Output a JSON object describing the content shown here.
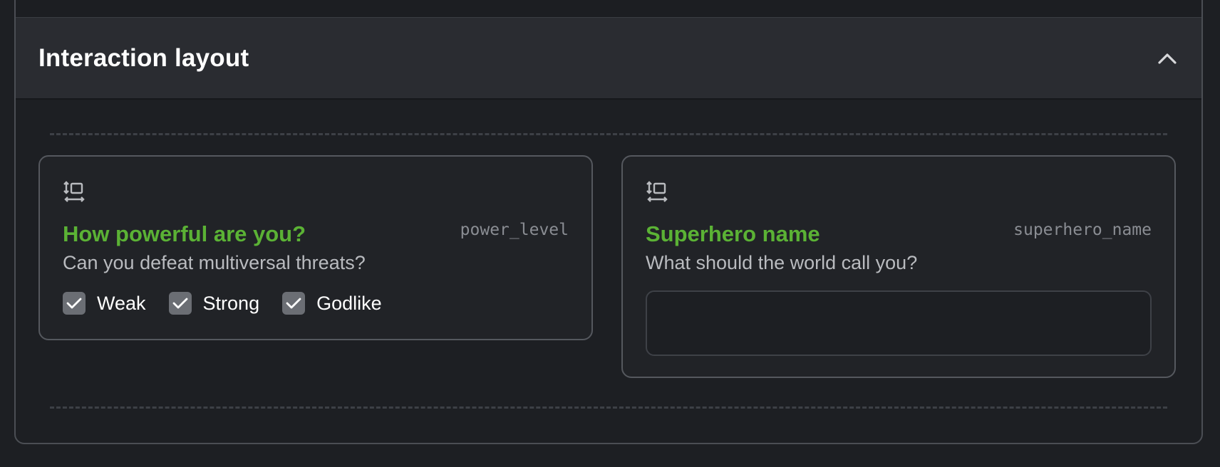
{
  "section": {
    "title": "Interaction layout",
    "collapse_icon": "chevron-up-icon"
  },
  "questions": [
    {
      "icon": "drag-handle-icon",
      "title": "How powerful are you?",
      "key": "power_level",
      "description": "Can you defeat multiversal threats?",
      "options": [
        {
          "label": "Weak",
          "checked": true
        },
        {
          "label": "Strong",
          "checked": true
        },
        {
          "label": "Godlike",
          "checked": true
        }
      ]
    },
    {
      "icon": "drag-handle-icon",
      "title": "Superhero name",
      "key": "superhero_name",
      "description": "What should the world call you?",
      "input_value": ""
    }
  ],
  "colors": {
    "accent": "#5bb235",
    "background": "#1d1f23",
    "header_bg": "#2a2c31",
    "card_border": "#55585e",
    "checkbox_bg": "#6b6e74"
  }
}
